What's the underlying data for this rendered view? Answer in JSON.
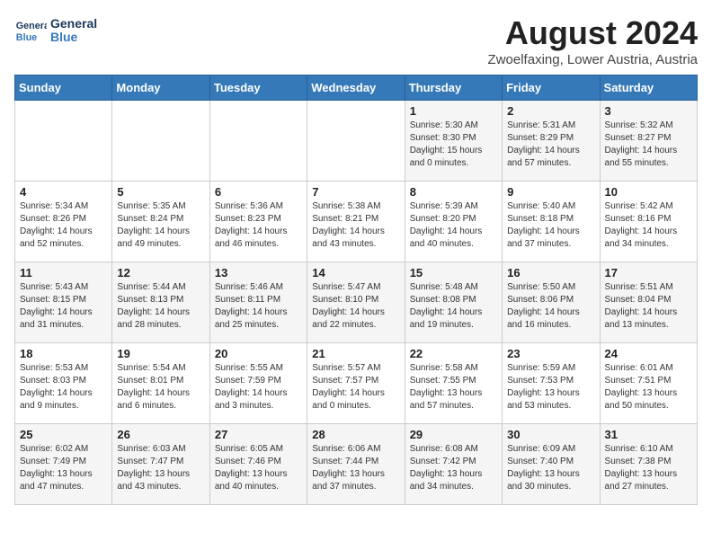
{
  "header": {
    "logo_line1": "General",
    "logo_line2": "Blue",
    "month": "August 2024",
    "location": "Zwoelfaxing, Lower Austria, Austria"
  },
  "weekdays": [
    "Sunday",
    "Monday",
    "Tuesday",
    "Wednesday",
    "Thursday",
    "Friday",
    "Saturday"
  ],
  "weeks": [
    [
      {
        "day": "",
        "info": ""
      },
      {
        "day": "",
        "info": ""
      },
      {
        "day": "",
        "info": ""
      },
      {
        "day": "",
        "info": ""
      },
      {
        "day": "1",
        "info": "Sunrise: 5:30 AM\nSunset: 8:30 PM\nDaylight: 15 hours\nand 0 minutes."
      },
      {
        "day": "2",
        "info": "Sunrise: 5:31 AM\nSunset: 8:29 PM\nDaylight: 14 hours\nand 57 minutes."
      },
      {
        "day": "3",
        "info": "Sunrise: 5:32 AM\nSunset: 8:27 PM\nDaylight: 14 hours\nand 55 minutes."
      }
    ],
    [
      {
        "day": "4",
        "info": "Sunrise: 5:34 AM\nSunset: 8:26 PM\nDaylight: 14 hours\nand 52 minutes."
      },
      {
        "day": "5",
        "info": "Sunrise: 5:35 AM\nSunset: 8:24 PM\nDaylight: 14 hours\nand 49 minutes."
      },
      {
        "day": "6",
        "info": "Sunrise: 5:36 AM\nSunset: 8:23 PM\nDaylight: 14 hours\nand 46 minutes."
      },
      {
        "day": "7",
        "info": "Sunrise: 5:38 AM\nSunset: 8:21 PM\nDaylight: 14 hours\nand 43 minutes."
      },
      {
        "day": "8",
        "info": "Sunrise: 5:39 AM\nSunset: 8:20 PM\nDaylight: 14 hours\nand 40 minutes."
      },
      {
        "day": "9",
        "info": "Sunrise: 5:40 AM\nSunset: 8:18 PM\nDaylight: 14 hours\nand 37 minutes."
      },
      {
        "day": "10",
        "info": "Sunrise: 5:42 AM\nSunset: 8:16 PM\nDaylight: 14 hours\nand 34 minutes."
      }
    ],
    [
      {
        "day": "11",
        "info": "Sunrise: 5:43 AM\nSunset: 8:15 PM\nDaylight: 14 hours\nand 31 minutes."
      },
      {
        "day": "12",
        "info": "Sunrise: 5:44 AM\nSunset: 8:13 PM\nDaylight: 14 hours\nand 28 minutes."
      },
      {
        "day": "13",
        "info": "Sunrise: 5:46 AM\nSunset: 8:11 PM\nDaylight: 14 hours\nand 25 minutes."
      },
      {
        "day": "14",
        "info": "Sunrise: 5:47 AM\nSunset: 8:10 PM\nDaylight: 14 hours\nand 22 minutes."
      },
      {
        "day": "15",
        "info": "Sunrise: 5:48 AM\nSunset: 8:08 PM\nDaylight: 14 hours\nand 19 minutes."
      },
      {
        "day": "16",
        "info": "Sunrise: 5:50 AM\nSunset: 8:06 PM\nDaylight: 14 hours\nand 16 minutes."
      },
      {
        "day": "17",
        "info": "Sunrise: 5:51 AM\nSunset: 8:04 PM\nDaylight: 14 hours\nand 13 minutes."
      }
    ],
    [
      {
        "day": "18",
        "info": "Sunrise: 5:53 AM\nSunset: 8:03 PM\nDaylight: 14 hours\nand 9 minutes."
      },
      {
        "day": "19",
        "info": "Sunrise: 5:54 AM\nSunset: 8:01 PM\nDaylight: 14 hours\nand 6 minutes."
      },
      {
        "day": "20",
        "info": "Sunrise: 5:55 AM\nSunset: 7:59 PM\nDaylight: 14 hours\nand 3 minutes."
      },
      {
        "day": "21",
        "info": "Sunrise: 5:57 AM\nSunset: 7:57 PM\nDaylight: 14 hours\nand 0 minutes."
      },
      {
        "day": "22",
        "info": "Sunrise: 5:58 AM\nSunset: 7:55 PM\nDaylight: 13 hours\nand 57 minutes."
      },
      {
        "day": "23",
        "info": "Sunrise: 5:59 AM\nSunset: 7:53 PM\nDaylight: 13 hours\nand 53 minutes."
      },
      {
        "day": "24",
        "info": "Sunrise: 6:01 AM\nSunset: 7:51 PM\nDaylight: 13 hours\nand 50 minutes."
      }
    ],
    [
      {
        "day": "25",
        "info": "Sunrise: 6:02 AM\nSunset: 7:49 PM\nDaylight: 13 hours\nand 47 minutes."
      },
      {
        "day": "26",
        "info": "Sunrise: 6:03 AM\nSunset: 7:47 PM\nDaylight: 13 hours\nand 43 minutes."
      },
      {
        "day": "27",
        "info": "Sunrise: 6:05 AM\nSunset: 7:46 PM\nDaylight: 13 hours\nand 40 minutes."
      },
      {
        "day": "28",
        "info": "Sunrise: 6:06 AM\nSunset: 7:44 PM\nDaylight: 13 hours\nand 37 minutes."
      },
      {
        "day": "29",
        "info": "Sunrise: 6:08 AM\nSunset: 7:42 PM\nDaylight: 13 hours\nand 34 minutes."
      },
      {
        "day": "30",
        "info": "Sunrise: 6:09 AM\nSunset: 7:40 PM\nDaylight: 13 hours\nand 30 minutes."
      },
      {
        "day": "31",
        "info": "Sunrise: 6:10 AM\nSunset: 7:38 PM\nDaylight: 13 hours\nand 27 minutes."
      }
    ]
  ]
}
